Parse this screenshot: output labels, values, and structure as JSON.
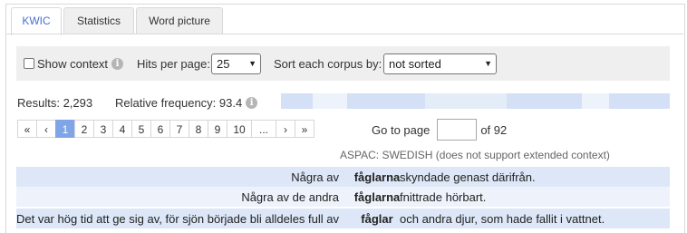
{
  "tabs": [
    "KWIC",
    "Statistics",
    "Word picture"
  ],
  "options": {
    "show_context_label": "Show context",
    "hits_per_page_label": "Hits per page:",
    "hits_per_page_value": "25",
    "sort_label": "Sort each corpus by:",
    "sort_value": "not sorted"
  },
  "results": {
    "label": "Results: 2,293",
    "relfreq_label": "Relative frequency: 93.4"
  },
  "colors": {
    "accent": "#4a6fd0",
    "active_page": "#7fa5e6",
    "row_even": "#dde7f7",
    "row_odd": "#eef3fb",
    "bar_light": "#e4ecf8",
    "bar_dark": "#d3e0f5"
  },
  "pager": {
    "items": [
      "«",
      "‹",
      "1",
      "2",
      "3",
      "4",
      "5",
      "6",
      "7",
      "8",
      "9",
      "10",
      "...",
      "›",
      "»"
    ],
    "active": "1",
    "goto_label": "Go to page",
    "of_label": "of 92"
  },
  "corpus_label": "ASPAC: SWEDISH (does not support extended context)",
  "kwic_rows": [
    {
      "left": "Några av",
      "kw": "fåglarna",
      "right": "skyndade genast därifrån."
    },
    {
      "left": "Några av de andra",
      "kw": "fåglarna",
      "right": "fnittrade hörbart."
    },
    {
      "left": "Det var hög tid att ge sig av, för sjön började bli alldeles full av",
      "kw": "fåglar",
      "right": "och andra djur, som hade fallit i vattnet."
    }
  ]
}
